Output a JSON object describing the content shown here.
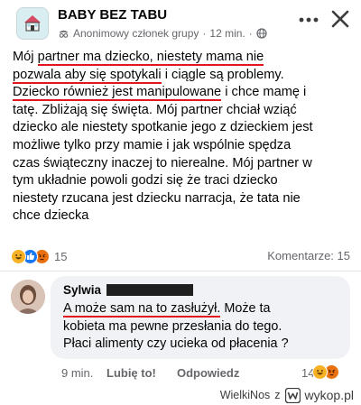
{
  "post": {
    "group_name": "BABY BEZ TABU",
    "author": "Anonimowy członek grupy",
    "separator": "·",
    "time": "12 min.",
    "separator2": "·",
    "lines": [
      [
        "",
        "Mój ",
        "partner ma dziecko, niestety mama nie",
        ""
      ],
      [
        "",
        "",
        "pozwala aby się spotykali",
        " i ciągle są problemy."
      ],
      [
        "",
        "",
        "Dziecko również jest manipulowane",
        " i chce mamę i"
      ],
      [
        "tatę. Zbliżają się święta. Mój partner chciał wziąć",
        "",
        "",
        ""
      ],
      [
        "dziecko ale niestety spotkanie jego z dzieckiem jest",
        "",
        "",
        ""
      ],
      [
        "możliwe tylko przy mamie i jak wspólnie spędza",
        "",
        "",
        ""
      ],
      [
        "czas świąteczny inaczej to nierealne. Mój partner w",
        "",
        "",
        ""
      ],
      [
        "tym układnie powoli godzi się że traci dziecko",
        "",
        "",
        ""
      ],
      [
        "niestety rzucana jest dziecku narracja, że tata nie",
        "",
        "",
        ""
      ],
      [
        "chce dziecka",
        "",
        "",
        ""
      ]
    ],
    "reaction_count": "15",
    "comments_label": "Komentarze: 15"
  },
  "comment": {
    "author": "Sylwia",
    "lines": [
      [
        "",
        "A może sam na to zasłużył.",
        " Może ta"
      ],
      [
        "kobieta ma pewne przesłania do tego.",
        "",
        ""
      ],
      [
        "Płaci alimenty czy ucieka od płacenia ?",
        "",
        ""
      ]
    ],
    "time": "9 min.",
    "like_label": "Lubię to!",
    "reply_label": "Odpowiedz",
    "reaction_count": "14"
  },
  "footer": {
    "user": "WielkiNos",
    "connector": "z",
    "brand": "wykop.pl"
  },
  "colors": {
    "underline": "#e2161d",
    "like_blue": "#1877f2",
    "haha_yellow": "#f7b125",
    "angry_orange": "#e9710f",
    "wykop_blue": "#1e73be"
  },
  "icons": {
    "group": "house-icon",
    "anon": "anonymous-mask-icon",
    "audience": "globe-icon",
    "more": "more-dots-icon",
    "close": "close-icon",
    "reactions": [
      "haha-icon",
      "like-icon",
      "angry-icon"
    ],
    "comment_reactions": [
      "haha-icon",
      "angry-icon"
    ],
    "brand": "wykop-logo-icon"
  }
}
